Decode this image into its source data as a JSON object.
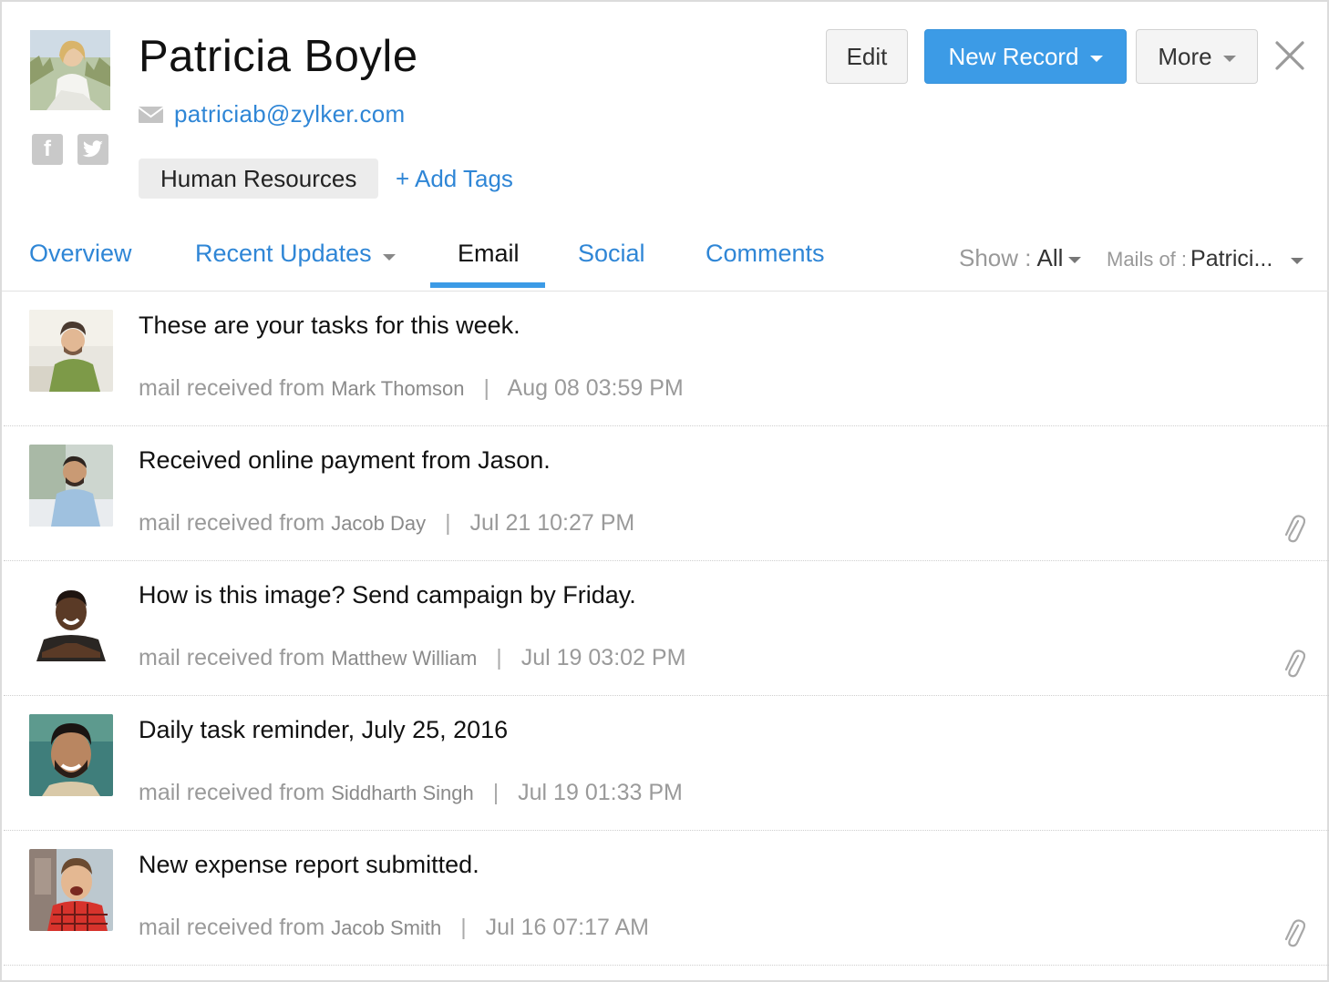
{
  "profile": {
    "name": "Patricia Boyle",
    "email": "patriciab@zylker.com",
    "tag": "Human Resources",
    "add_tags_label": "+ Add Tags"
  },
  "toolbar": {
    "edit_label": "Edit",
    "new_record_label": "New Record",
    "more_label": "More"
  },
  "tabs": [
    {
      "label": "Overview"
    },
    {
      "label": "Recent Updates"
    },
    {
      "label": "Email"
    },
    {
      "label": "Social"
    },
    {
      "label": "Comments"
    }
  ],
  "filters": {
    "show_label": "Show :",
    "show_value": "All",
    "mails_of_label": "Mails of :",
    "mails_of_value": "Patrici..."
  },
  "mails": [
    {
      "subject": "These are your tasks for this week.",
      "prefix": "mail received from",
      "sender": "Mark Thomson",
      "date": "Aug 08 03:59 PM",
      "attachment": false
    },
    {
      "subject": "Received online payment from Jason.",
      "prefix": "mail received from",
      "sender": "Jacob Day",
      "date": "Jul 21 10:27 PM",
      "attachment": true
    },
    {
      "subject": "How is this image? Send campaign by Friday.",
      "prefix": "mail received from",
      "sender": "Matthew William",
      "date": "Jul 19 03:02 PM",
      "attachment": true
    },
    {
      "subject": "Daily task reminder, July 25, 2016",
      "prefix": "mail received from",
      "sender": "Siddharth Singh",
      "date": "Jul 19 01:33 PM",
      "attachment": false
    },
    {
      "subject": "New expense report submitted.",
      "prefix": "mail received from",
      "sender": "Jacob Smith",
      "date": "Jul 16 07:17 AM",
      "attachment": true
    }
  ],
  "colors": {
    "accent": "#3c9be6",
    "link": "#2f86d6",
    "muted": "#9a9a9a"
  },
  "icons": {
    "social": [
      "facebook-icon",
      "twitter-icon"
    ],
    "email": "envelope-icon",
    "close": "close-icon",
    "attachment": "paperclip-icon"
  }
}
